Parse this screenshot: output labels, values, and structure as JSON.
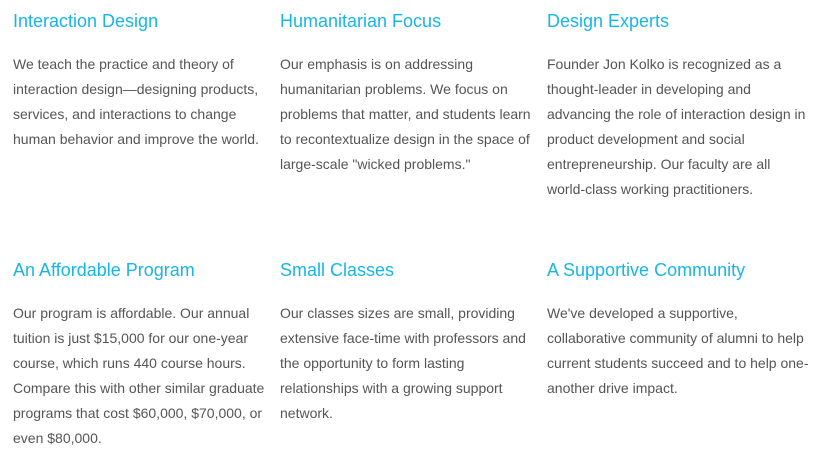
{
  "features": [
    {
      "title": "Interaction Design",
      "body": "We teach the practice and theory of interaction design—designing products, services, and interactions to change human behavior and improve the world."
    },
    {
      "title": "Humanitarian Focus",
      "body": "Our emphasis is on addressing humanitarian problems. We focus on problems that matter, and students learn to recontextualize design in the space of large-scale \"wicked problems.\""
    },
    {
      "title": "Design Experts",
      "body": "Founder Jon Kolko is recognized as a thought-leader in developing and advancing the role of interaction design in product development and social entrepreneurship. Our faculty are all world-class working practitioners."
    },
    {
      "title": "An Affordable Program",
      "body": "Our program is affordable. Our annual tuition is just $15,000 for our one-year course, which runs 440 course hours. Compare this with other similar graduate programs that cost $60,000, $70,000, or even $80,000."
    },
    {
      "title": "Small Classes",
      "body": "Our classes sizes are small, providing extensive face-time with professors and the opportunity to form lasting relationships with a growing support network."
    },
    {
      "title": "A Supportive Community",
      "body": "We've developed a supportive, collaborative community of alumni to help current students succeed and to help one-another drive impact."
    }
  ],
  "colors": {
    "heading": "#17b6e6",
    "body_text": "#555555",
    "background": "#ffffff"
  }
}
